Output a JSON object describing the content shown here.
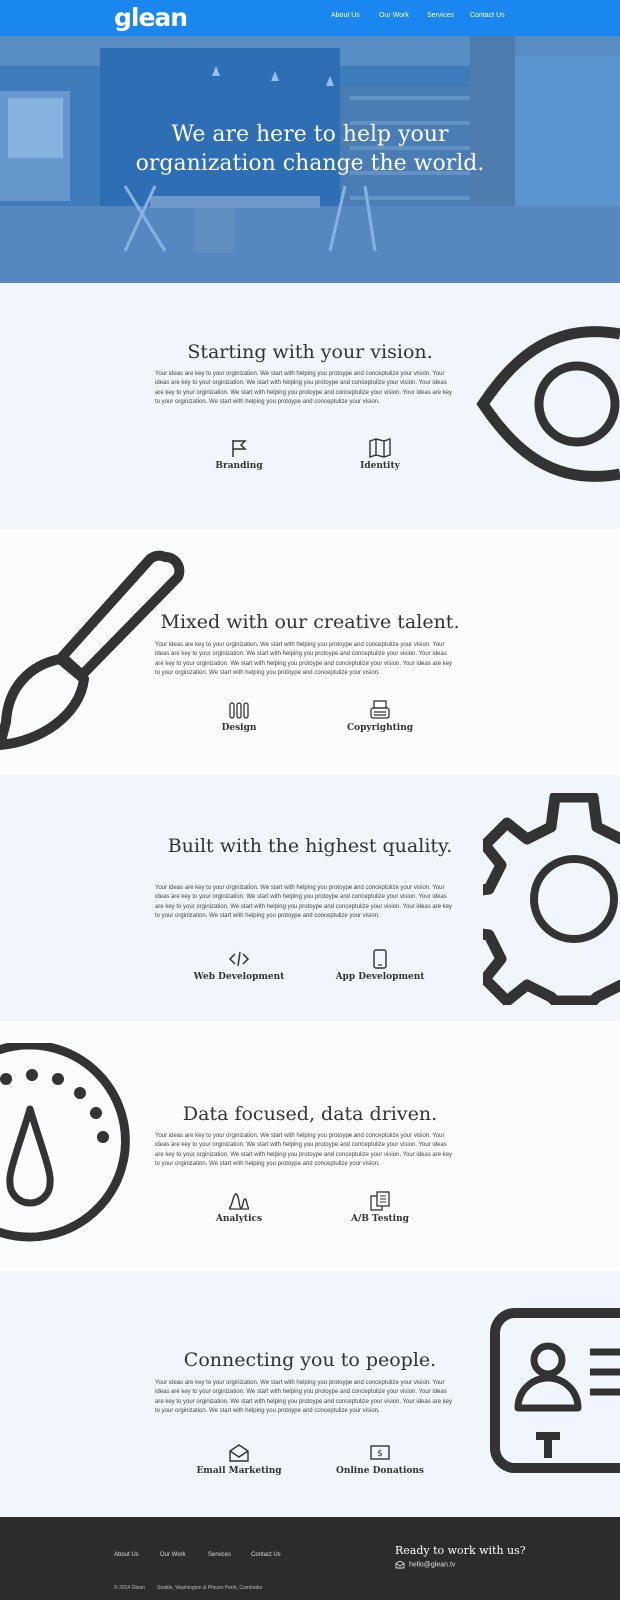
{
  "brand": {
    "logo": "glean",
    "accent": "#1a86f0",
    "footer_bg": "#2c2c2c"
  },
  "nav": {
    "items": [
      "About Us",
      "Our Work",
      "Services",
      "Contact Us"
    ]
  },
  "hero": {
    "title_line1": "We are here to help your",
    "title_line2": "organization change the world."
  },
  "body_text": "Your ideas are key to your orginization. We start with helping you protoype and conceptulize your vision. Your ideas are key to your orginization. We start with helping you protoype and conceptulize your vision. Your ideas are key to your orginization. We start with helping you protoype and conceptulize your vision. Your ideas are key to your orginization. We start with helping you protoype and conceptulize your vision.",
  "sections": [
    {
      "title": "Starting with your vision.",
      "big_icon": "eye-icon",
      "features": [
        {
          "label": "Branding",
          "icon": "flag-icon"
        },
        {
          "label": "Identity",
          "icon": "map-icon"
        }
      ]
    },
    {
      "title": "Mixed with our creative talent.",
      "big_icon": "paintbrush-icon",
      "features": [
        {
          "label": "Design",
          "icon": "pencils-icon"
        },
        {
          "label": "Copyrighting",
          "icon": "typewriter-icon"
        }
      ]
    },
    {
      "title": "Built with the highest quality.",
      "big_icon": "gear-icon",
      "features": [
        {
          "label": "Web Development",
          "icon": "code-icon"
        },
        {
          "label": "App Development",
          "icon": "phone-icon"
        }
      ]
    },
    {
      "title": "Data focused, data driven.",
      "big_icon": "speedometer-icon",
      "features": [
        {
          "label": "Analytics",
          "icon": "chart-icon"
        },
        {
          "label": "A/B Testing",
          "icon": "documents-icon"
        }
      ]
    },
    {
      "title": "Connecting you to people.",
      "big_icon": "id-card-icon",
      "features": [
        {
          "label": "Email Marketing",
          "icon": "envelope-icon"
        },
        {
          "label": "Online Donations",
          "icon": "money-icon"
        }
      ]
    }
  ],
  "footer": {
    "links": [
      "About Us",
      "Our Work",
      "Services",
      "Contact Us"
    ],
    "cta": "Ready to work with us?",
    "email": "hello@glean.tv",
    "copyright": "© 2014 Glean",
    "locations": "Seattle, Washington & Phnom Penh, Cambodia"
  }
}
